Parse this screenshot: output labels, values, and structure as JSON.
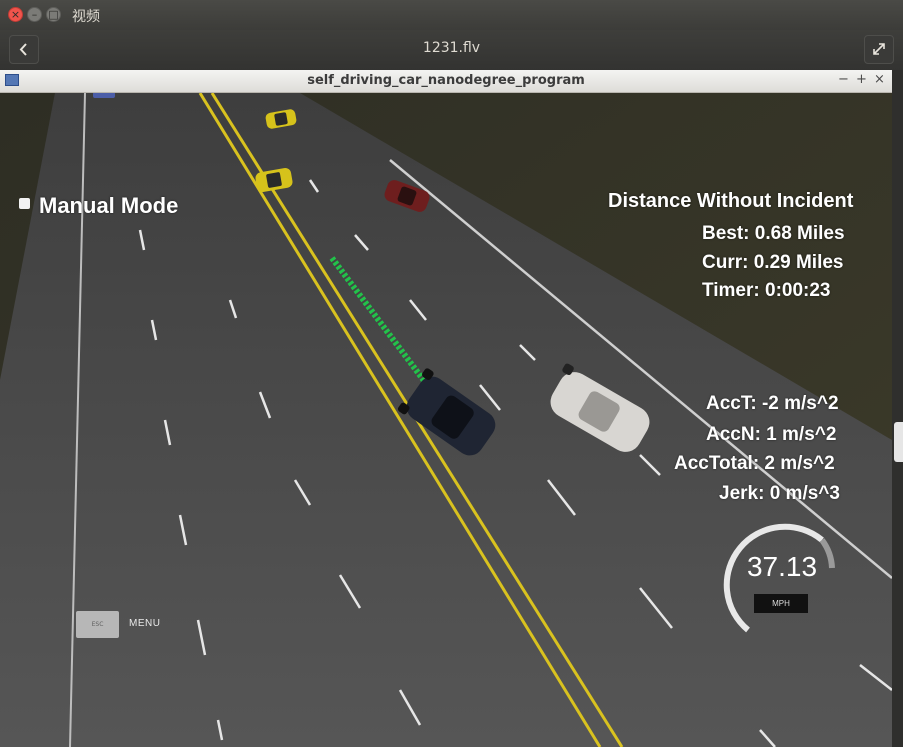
{
  "window": {
    "title": "视频",
    "close_glyph": "×",
    "min_glyph": "–",
    "max_glyph": "□"
  },
  "player": {
    "file_name": "1231.flv",
    "back_icon": "chevron-left-icon",
    "fullscreen_icon": "expand-icon"
  },
  "sim_window": {
    "title": "self_driving_car_nanodegree_program",
    "controls": [
      "−",
      "+",
      "×"
    ]
  },
  "hud": {
    "mode_label": "Manual Mode",
    "distance_title": "Distance Without Incident",
    "best": "Best: 0.68 Miles",
    "curr": "Curr: 0.29 Miles",
    "timer": "Timer: 0:00:23",
    "acc_t": "AccT: -2 m/s^2",
    "acc_n": "AccN: 1 m/s^2",
    "acc_total": "AccTotal: 2 m/s^2",
    "jerk": "Jerk: 0 m/s^3",
    "speed": "37.13",
    "speed_unit": "MPH",
    "esc_label": "ESC",
    "menu_label": "MENU"
  },
  "colors": {
    "path": "#22c24a",
    "lane_yellow": "#d9c21f",
    "road": "#4d4d4d",
    "grass": "#3a3a28"
  }
}
